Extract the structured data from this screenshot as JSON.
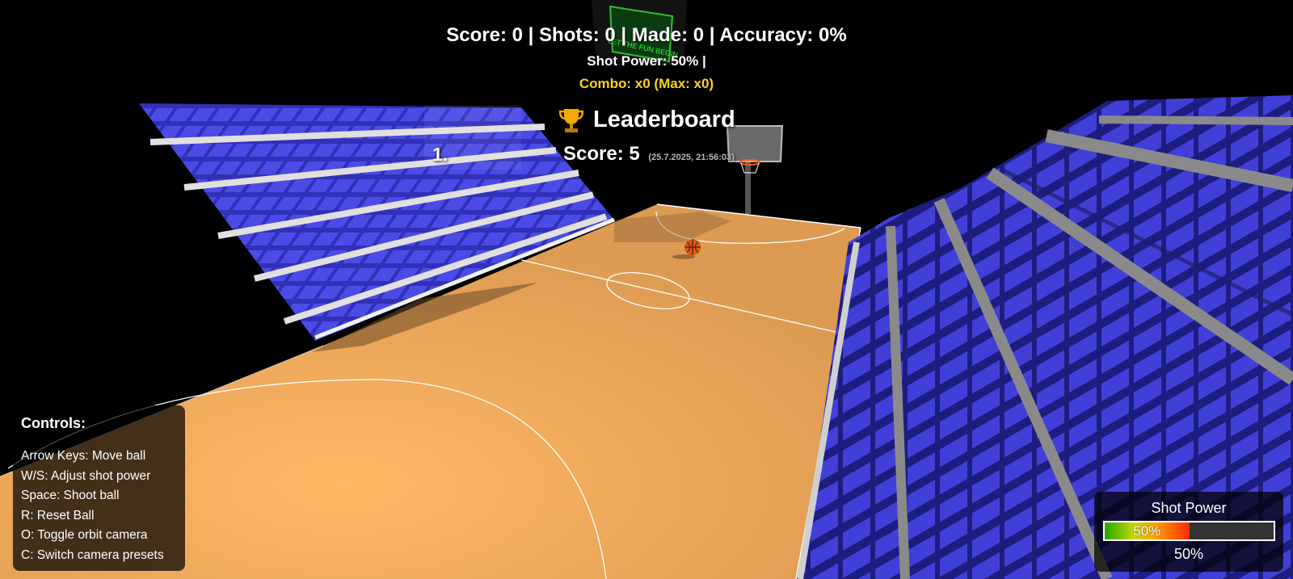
{
  "hud": {
    "score_line": "Score: 0 | Shots: 0 | Made: 0 | Accuracy: 0%",
    "power_line": "Shot Power: 50% |",
    "combo_line": "Combo: x0 (Max: x0)"
  },
  "leaderboard": {
    "title": "Leaderboard",
    "entries": [
      {
        "rank": "1.",
        "score": "Score: 5",
        "date": "(25.7.2025, 21:56:03)"
      }
    ]
  },
  "controls": {
    "title": "Controls:",
    "items": [
      "Arrow Keys: Move ball",
      "W/S: Adjust shot power",
      "Space: Shoot ball",
      "R: Reset Ball",
      "O: Toggle orbit camera",
      "C: Switch camera presets"
    ]
  },
  "power_meter": {
    "title": "Shot Power",
    "fill_label": "50%",
    "value_label": "50%",
    "level": 0.5
  },
  "scoreboard_sign": {
    "text": "LET THE FUN BEGIN"
  },
  "icons": {
    "trophy": "trophy-icon"
  },
  "colors": {
    "court": "#e8a358",
    "court_light": "#f7b768",
    "seat": "#4646e0",
    "seat_dark": "#2a2aa0",
    "step": "#d8d8d8",
    "combo": "#ffd21f",
    "background": "#000000"
  }
}
